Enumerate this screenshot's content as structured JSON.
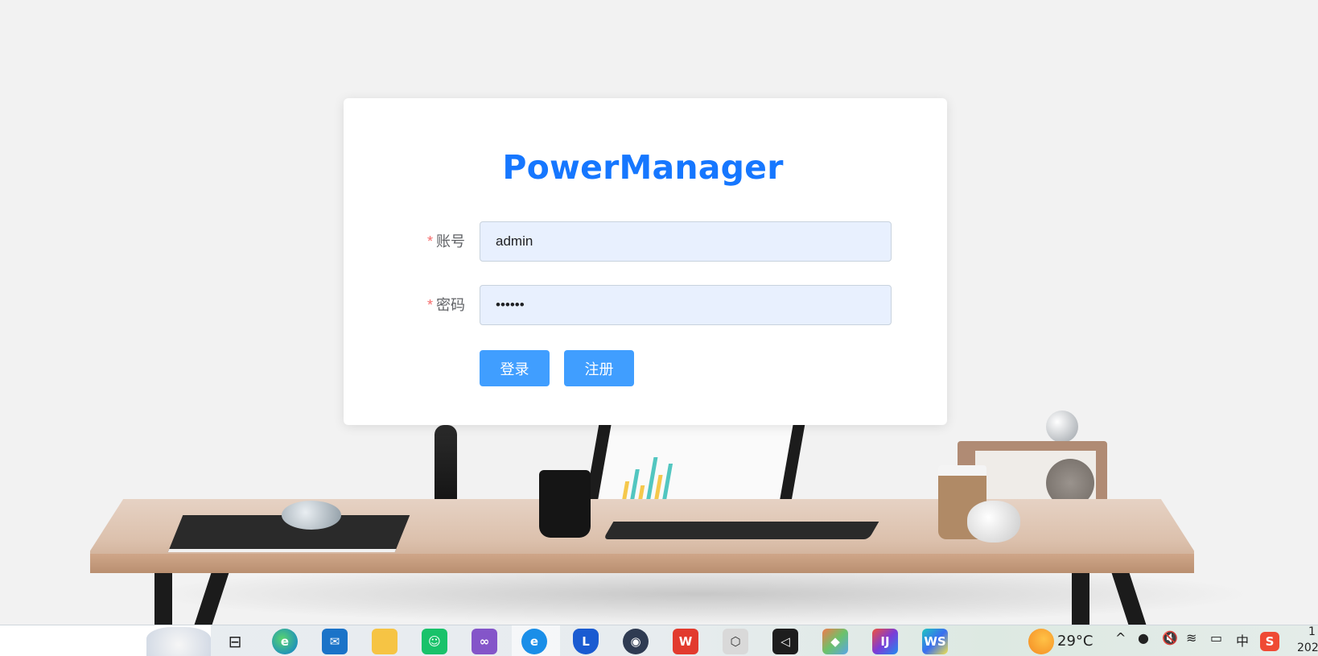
{
  "app": {
    "title": "PowerManager"
  },
  "form": {
    "account": {
      "required_mark": "*",
      "label": "账号",
      "value": "admin"
    },
    "password": {
      "required_mark": "*",
      "label": "密码",
      "value": "••••••"
    },
    "buttons": {
      "login": "登录",
      "register": "注册"
    }
  },
  "taskbar": {
    "apps": [
      {
        "name": "task-view"
      },
      {
        "name": "edge"
      },
      {
        "name": "mail"
      },
      {
        "name": "file-explorer"
      },
      {
        "name": "shopping"
      },
      {
        "name": "visual-studio"
      },
      {
        "name": "internet-explorer"
      },
      {
        "name": "lenovo-vantage"
      },
      {
        "name": "browser"
      },
      {
        "name": "wps-office"
      },
      {
        "name": "unity-hub"
      },
      {
        "name": "unity"
      },
      {
        "name": "git"
      },
      {
        "name": "intellij-idea"
      },
      {
        "name": "webstorm"
      }
    ],
    "weather": {
      "temperature": "29°C"
    },
    "tray": {
      "ime": "中",
      "clock_partial_time": "1",
      "clock_partial_date": "202"
    }
  },
  "colors": {
    "brand": "#1677ff",
    "button": "#409eff",
    "required": "#f56c6c",
    "input_bg": "#e8f0fe"
  }
}
